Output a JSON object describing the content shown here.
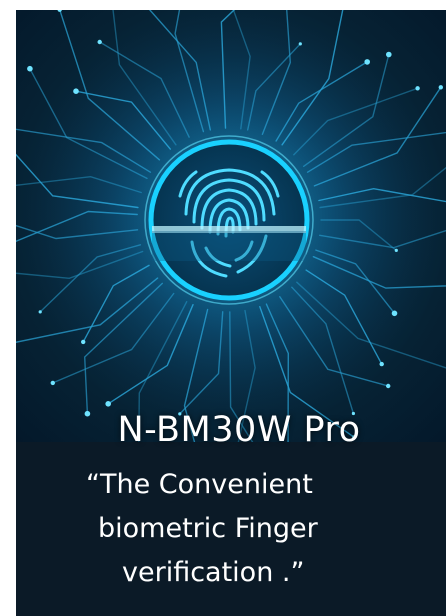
{
  "product": {
    "name": "N-BM30W Pro"
  },
  "tagline": {
    "line1": "“The Convenient",
    "line2": "biometric Finger",
    "line3": "verification .”"
  },
  "colors": {
    "background_dark": "#0b1a27",
    "circuit_glow": "#39c7ff",
    "ring": "#19d1ff",
    "text": "#ffffff"
  },
  "icons": {
    "hero": "fingerprint-icon"
  }
}
